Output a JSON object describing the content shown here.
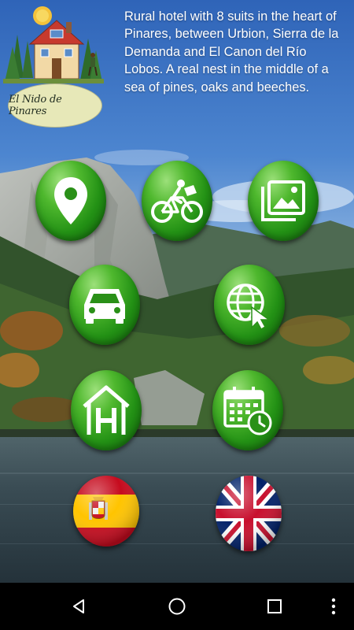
{
  "app": {
    "logo_text": "El Nido de Pinares",
    "description": "Rural hotel with 8 suits in the heart of Pinares, between Urbion, Sierra de la Demanda and El Canon del Río Lobos. A real nest in the middle of a sea of pines, oaks and beeches."
  },
  "buttons": [
    {
      "name": "location-button",
      "icon": "map-pin-icon"
    },
    {
      "name": "cycling-button",
      "icon": "cyclist-icon"
    },
    {
      "name": "gallery-button",
      "icon": "image-gallery-icon"
    },
    {
      "name": "directions-car-button",
      "icon": "car-icon"
    },
    {
      "name": "website-button",
      "icon": "globe-cursor-icon"
    },
    {
      "name": "hotel-button",
      "icon": "hotel-h-icon"
    },
    {
      "name": "booking-calendar-button",
      "icon": "calendar-clock-icon"
    }
  ],
  "languages": [
    {
      "name": "spanish-language-button",
      "icon": "spain-flag-icon"
    },
    {
      "name": "english-language-button",
      "icon": "uk-flag-icon"
    }
  ],
  "navbar": {
    "back": "back-triangle-icon",
    "home": "home-circle-icon",
    "recents": "recents-square-icon",
    "menu": "overflow-menu-icon"
  },
  "colors": {
    "button_green": "#239115",
    "sky": "#3f78c6",
    "lake": "#2c3c44",
    "navbar": "#000000"
  }
}
